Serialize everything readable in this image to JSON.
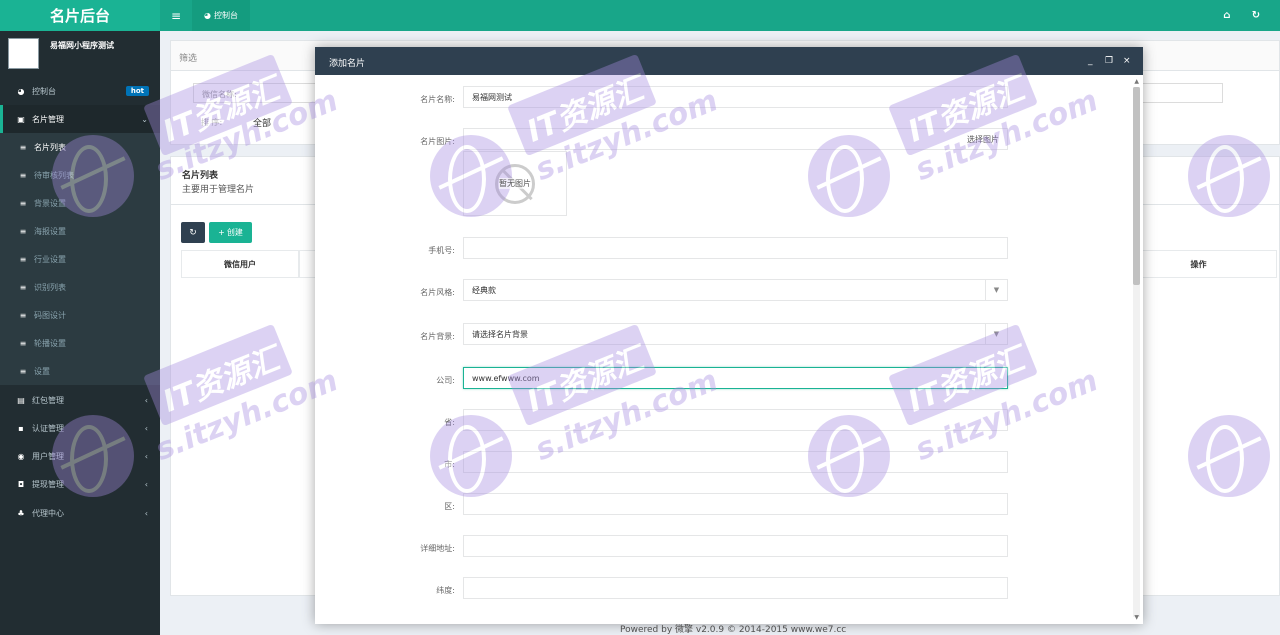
{
  "app": {
    "brand": "名片后台",
    "top_tab": "控制台"
  },
  "profile": {
    "name": "易福网小程序测试"
  },
  "sidebar": {
    "items": [
      {
        "label": "控制台",
        "icon": "dashboard-icon",
        "badge": "hot"
      },
      {
        "label": "名片管理",
        "icon": "card-icon"
      },
      {
        "label": "名片列表"
      },
      {
        "label": "待审核列表"
      },
      {
        "label": "背景设置"
      },
      {
        "label": "海报设置"
      },
      {
        "label": "行业设置"
      },
      {
        "label": "识别列表"
      },
      {
        "label": "码图设计"
      },
      {
        "label": "轮播设置"
      },
      {
        "label": "设置"
      },
      {
        "label": "红包管理"
      },
      {
        "label": "认证管理"
      },
      {
        "label": "用户管理"
      },
      {
        "label": "提现管理"
      },
      {
        "label": "代理中心"
      }
    ]
  },
  "main": {
    "filter_title": "筛选",
    "filter_label": "微信名称:",
    "sort_label": "排  序:",
    "sort_value": "全部",
    "list_title": "名片列表",
    "list_subtitle": "主要用于管理名片",
    "create_label": "创建",
    "col_user": "微信用户",
    "col_action": "操作"
  },
  "modal": {
    "title": "添加名片",
    "fields": {
      "name": {
        "label": "名片名称:",
        "value": "易福网测试"
      },
      "image": {
        "label": "名片图片:",
        "button": "选择图片",
        "placeholder_text": "暂无图片"
      },
      "phone": {
        "label": "手机号:",
        "value": ""
      },
      "style": {
        "label": "名片风格:",
        "value": "经典款"
      },
      "background": {
        "label": "名片背景:",
        "value": "请选择名片背景"
      },
      "company": {
        "label": "公司:",
        "value": "www.efwww.com"
      },
      "province": {
        "label": "省:",
        "value": ""
      },
      "city": {
        "label": "市:",
        "value": ""
      },
      "district": {
        "label": "区:",
        "value": ""
      },
      "address": {
        "label": "详细地址:",
        "value": ""
      },
      "latitude": {
        "label": "纬度:",
        "value": ""
      }
    }
  },
  "footer": {
    "text": "Powered by 微擎 v2.0.9 © 2014-2015 www.we7.cc"
  },
  "watermark": {
    "stamp": "IT资源汇",
    "url": "s.itzyh.com"
  },
  "colors": {
    "accent": "#1ab394",
    "sidebar": "#222d32",
    "modal_header": "#2f4050",
    "badge": "#0073b7"
  }
}
